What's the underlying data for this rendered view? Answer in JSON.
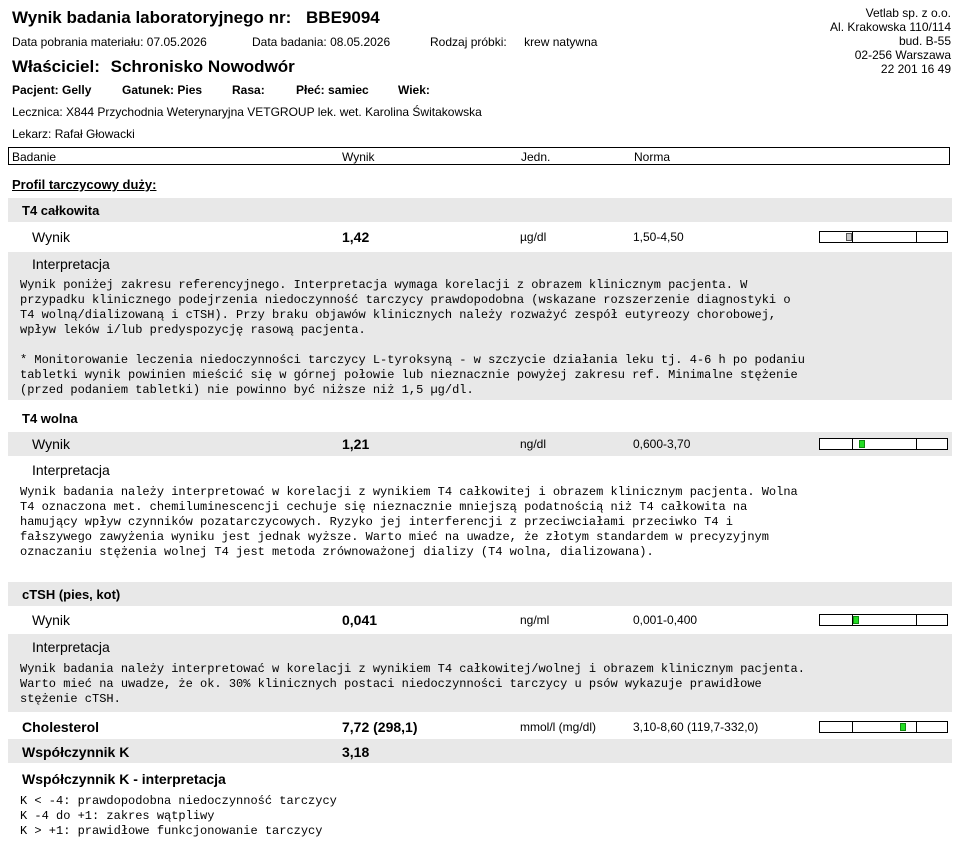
{
  "header": {
    "title_prefix": "Wynik badania laboratoryjnego nr:",
    "report_number": "BBE9094",
    "sample_date_label": "Data pobrania materiału:",
    "sample_date": "07.05.2026",
    "test_date_label": "Data badania:",
    "test_date": "08.05.2026",
    "sample_type_label": "Rodzaj próbki:",
    "sample_type": "krew natywna",
    "owner_label": "Właściciel:",
    "owner": "Schronisko Nowodwór",
    "patient_label": "Pacjent:",
    "patient": "Gelly",
    "species_label": "Gatunek:",
    "species": "Pies",
    "breed_label": "Rasa:",
    "breed": "",
    "sex_label": "Płeć:",
    "sex": "samiec",
    "age_label": "Wiek:",
    "age": "",
    "clinic_label": "Lecznica:",
    "clinic": "X844 Przychodnia Weterynaryjna VETGROUP lek. wet. Karolina Świtakowska",
    "doctor_label": "Lekarz:",
    "doctor": "Rafał Głowacki"
  },
  "lab": {
    "name": "Vetlab sp. z o.o.",
    "street": "Al. Krakowska 110/114",
    "building": "bud. B-55",
    "city": "02-256 Warszawa",
    "phone": "22 201 16 49"
  },
  "columns": {
    "test": "Badanie",
    "result": "Wynik",
    "unit": "Jedn.",
    "norm": "Norma"
  },
  "section_title": "Profil tarczycowy duży:",
  "result_label": "Wynik",
  "interpretation_label": "Interpretacja",
  "tests": [
    {
      "name": "T4 całkowita",
      "value": "1,42",
      "unit": "µg/dl",
      "norm": "1,50-4,50",
      "gauge_position": 0.23,
      "status": "low",
      "interpretation": "Wynik poniżej zakresu referencyjnego. Interpretacja wymaga korelacji z obrazem klinicznym pacjenta. W\nprzypadku klinicznego podejrzenia niedoczynność tarczycy prawdopodobna (wskazane rozszerzenie diagnostyki o\nT4 wolną/dializowaną i cTSH). Przy braku objawów klinicznych należy rozważyć zespół eutyreozy chorobowej,\nwpływ leków i/lub predyspozycję rasową pacjenta.\n\n* Monitorowanie leczenia niedoczynności tarczycy L-tyroksyną - w szczycie działania leku tj. 4-6 h po podaniu\ntabletki wynik powinien mieścić się w górnej połowie lub nieznacznie powyżej zakresu ref. Minimalne stężenie\n(przed podaniem tabletki) nie powinno być niższe niż 1,5 µg/dl."
    },
    {
      "name": "T4 wolna",
      "value": "1,21",
      "unit": "ng/dl",
      "norm": "0,600-3,70",
      "gauge_position": 0.33,
      "status": "ok",
      "interpretation": "Wynik badania należy interpretować w korelacji z wynikiem T4 całkowitej i obrazem klinicznym pacjenta. Wolna\nT4 oznaczona met. chemiluminescencji cechuje się nieznacznie mniejszą podatnością niż T4 całkowita na\nhamujący wpływ czynników pozatarczycowych. Ryzyko jej interferencji z przeciwciałami przeciwko T4 i\nfałszywego zawyżenia wyniku jest jednak wyższe. Warto mieć na uwadze, że złotym standardem w precyzyjnym\noznaczaniu stężenia wolnej T4 jest metoda zrównoważonej dializy (T4 wolna, dializowana)."
    },
    {
      "name": "cTSH (pies, kot)",
      "value": "0,041",
      "unit": "ng/ml",
      "norm": "0,001-0,400",
      "gauge_position": 0.28,
      "status": "ok",
      "interpretation": "Wynik badania należy interpretować w korelacji z wynikiem T4 całkowitej/wolnej i obrazem klinicznym pacjenta.\nWarto mieć na uwadze, że ok. 30% klinicznych postaci niedoczynności tarczycy u psów wykazuje prawidłowe\nstężenie cTSH."
    }
  ],
  "cholesterol": {
    "name": "Cholesterol",
    "value": "7,72 (298,1)",
    "unit": "mmol/l (mg/dl)",
    "norm": "3,10-8,60 (119,7-332,0)",
    "gauge_position": 0.65,
    "status": "ok"
  },
  "k_factor": {
    "name": "Współczynnik K",
    "value": "3,18",
    "interpretation_title": "Współczynnik K - interpretacja",
    "interpretation": "K < -4: prawdopodobna niedoczynność tarczycy\nK -4 do +1: zakres wątpliwy\nK > +1: prawidłowe funkcjonowanie tarczycy"
  }
}
